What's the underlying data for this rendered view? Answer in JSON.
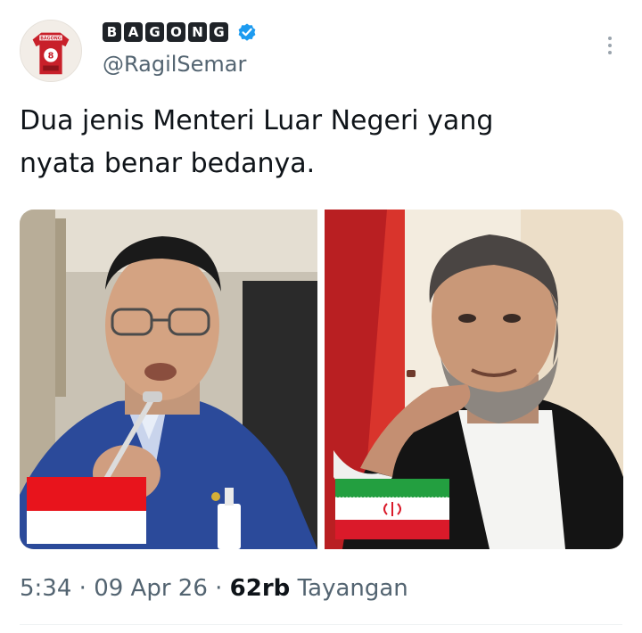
{
  "author": {
    "display_name_letters": [
      "B",
      "A",
      "G",
      "O",
      "N",
      "G"
    ],
    "handle": "@RagilSemar",
    "verified": true,
    "avatar_jersey_text": "BAGONG",
    "avatar_jersey_number": "8"
  },
  "tweet": {
    "text": "Dua jenis Menteri Luar Negeri yang\nnyata benar bedanya."
  },
  "media": {
    "left_flag": "indonesia",
    "right_flag": "iran"
  },
  "meta": {
    "time": "5:34",
    "separator": " · ",
    "date": "09 Apr 26",
    "views_count": "62rb",
    "views_label": "Tayangan"
  },
  "icons": {
    "verified": "verified-badge-icon",
    "more": "more-options-icon"
  },
  "colors": {
    "verified_blue": "#1d9bf0",
    "secondary_text": "#536471",
    "indonesia_red": "#e8141c",
    "iran_green": "#239f40",
    "iran_red": "#da1a2a"
  }
}
